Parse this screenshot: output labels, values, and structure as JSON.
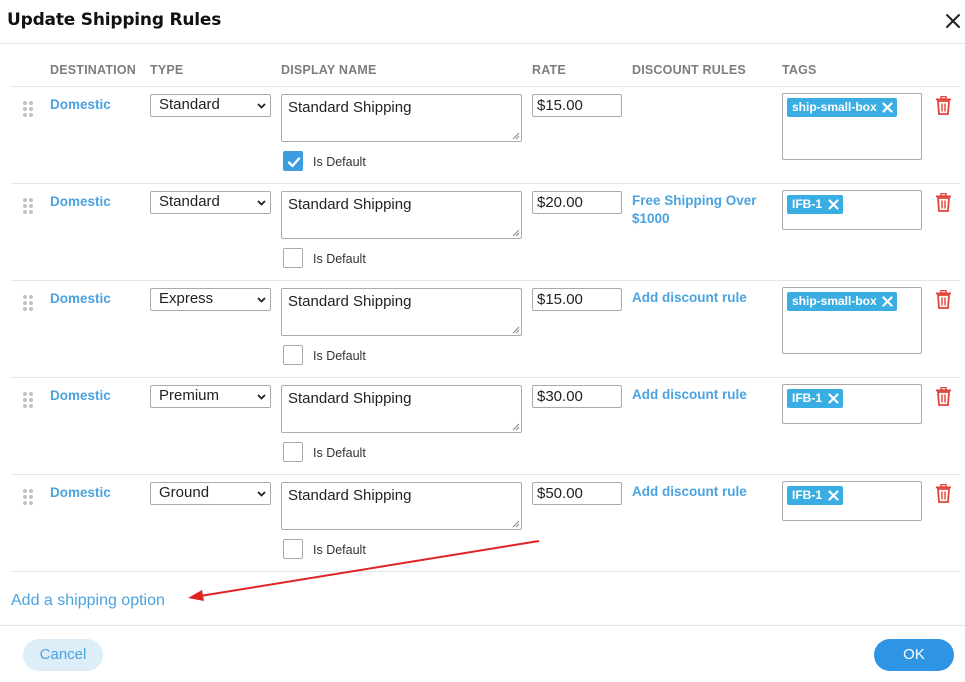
{
  "dialog": {
    "title": "Update Shipping Rules"
  },
  "columns": {
    "destination": "DESTINATION",
    "type": "TYPE",
    "display_name": "DISPLAY NAME",
    "rate": "RATE",
    "discount_rules": "DISCOUNT RULES",
    "tags": "TAGS"
  },
  "rows": [
    {
      "destination": "Domestic",
      "type": "Standard",
      "display_name": "Standard Shipping",
      "rate": "$15.00",
      "is_default_label": "Is Default",
      "is_default": true,
      "discount": "",
      "tag": "ship-small-box"
    },
    {
      "destination": "Domestic",
      "type": "Standard",
      "display_name": "Standard Shipping",
      "rate": "$20.00",
      "is_default_label": "Is Default",
      "is_default": false,
      "discount": "Free Shipping Over $1000",
      "tag": "IFB-1"
    },
    {
      "destination": "Domestic",
      "type": "Express",
      "display_name": "Standard Shipping",
      "rate": "$15.00",
      "is_default_label": "Is Default",
      "is_default": false,
      "discount": "Add discount rule",
      "tag": "ship-small-box"
    },
    {
      "destination": "Domestic",
      "type": "Premium",
      "display_name": "Standard Shipping",
      "rate": "$30.00",
      "is_default_label": "Is Default",
      "is_default": false,
      "discount": "Add discount rule",
      "tag": "IFB-1"
    },
    {
      "destination": "Domestic",
      "type": "Ground",
      "display_name": "Standard Shipping",
      "rate": "$50.00",
      "is_default_label": "Is Default",
      "is_default": false,
      "discount": "Add discount rule",
      "tag": "IFB-1"
    }
  ],
  "add_option_label": "Add a shipping option",
  "footer": {
    "cancel_label": "Cancel",
    "ok_label": "OK"
  },
  "colors": {
    "link": "#4aa3e0",
    "tag": "#3aaee2",
    "primary": "#2e95e4",
    "delete": "#e0453c",
    "annotation_arrow": "#e02424"
  },
  "icons": [
    "close-icon",
    "drag-handle-icon",
    "chevron-down-icon",
    "checkmark-icon",
    "tag-remove-icon",
    "trash-icon"
  ]
}
